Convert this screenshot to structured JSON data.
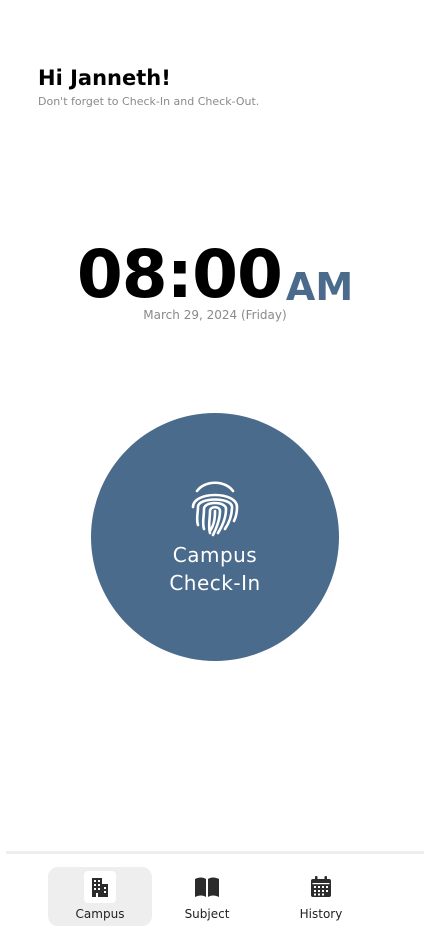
{
  "greeting": {
    "title": "Hi Janneth!",
    "subtitle": "Don't forget to Check-In and Check-Out."
  },
  "clock": {
    "time": "08:00",
    "period": "AM",
    "date": "March 29, 2024 (Friday)"
  },
  "checkin": {
    "line1": "Campus",
    "line2": "Check-In",
    "icon": "fingerprint-icon"
  },
  "nav": {
    "items": [
      {
        "label": "Campus",
        "icon": "building-icon",
        "active": true
      },
      {
        "label": "Subject",
        "icon": "book-icon",
        "active": false
      },
      {
        "label": "History",
        "icon": "calendar-icon",
        "active": false
      }
    ]
  },
  "colors": {
    "accent": "#4a6b8c",
    "muted_text": "#8a8a8a",
    "nav_active_bg": "#eeeeee"
  }
}
